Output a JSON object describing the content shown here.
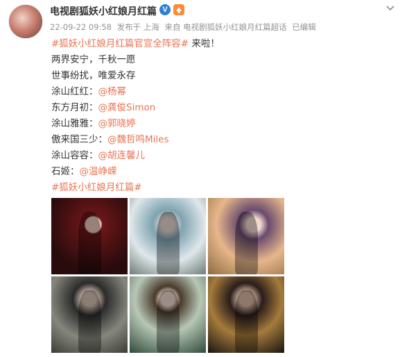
{
  "post": {
    "username": "电视剧狐妖小红娘月红篇",
    "verified_label": "V",
    "meta": {
      "time": "22-09-22 09:58",
      "location": "发布于 上海",
      "source": "来自 电视剧狐妖小红娘月红篇超话",
      "edited": "已编辑"
    },
    "lines": [
      {
        "link": "#狐妖小红娘月红篇官宣全阵容#",
        "text": " 来啦！"
      },
      {
        "link": "",
        "text": "两界安宁，千秋一愿"
      },
      {
        "link": "",
        "text": "世事纷扰，唯爱永存"
      },
      {
        "text": "涂山红红：",
        "link": "@杨幂"
      },
      {
        "text": "东方月初：",
        "link": "@龚俊Simon"
      },
      {
        "text": "涂山雅雅：",
        "link": "@郭晓婷"
      },
      {
        "text": "傲来国三少：",
        "link": "@魏哲鸣Miles"
      },
      {
        "text": "涂山容容：",
        "link": "@胡连馨儿"
      },
      {
        "text": "石姬：",
        "link": "@温峥嵘"
      },
      {
        "link": "#狐妖小红娘月红篇#",
        "text": ""
      }
    ]
  },
  "colors": {
    "link": "#eb7350",
    "meta": "#939393",
    "verified": "#2f7fd6"
  },
  "icons": {
    "verified": "verified-v-icon",
    "member": "member-badge-icon",
    "menu": "chevron-down-icon"
  }
}
